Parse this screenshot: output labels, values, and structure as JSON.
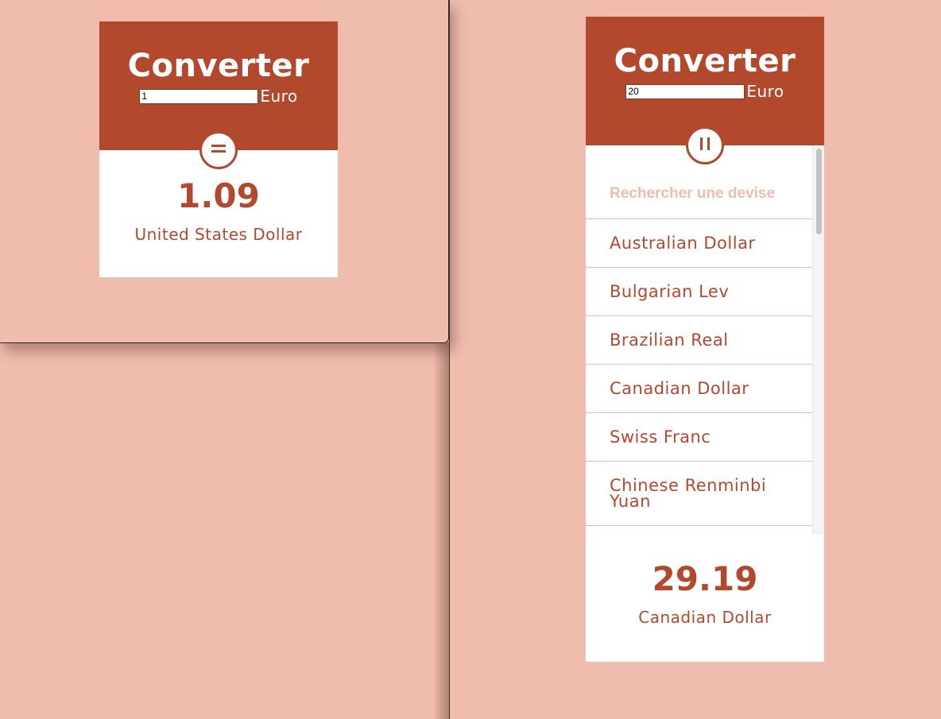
{
  "left_converter": {
    "title": "Converter",
    "amount_value": "1",
    "from_currency": "Euro",
    "toggle_icon": "equals-icon",
    "result_value": "1.09",
    "result_currency": "United States Dollar"
  },
  "right_converter": {
    "title": "Converter",
    "amount_value": "20",
    "from_currency": "Euro",
    "toggle_icon": "pause-icon",
    "search_placeholder": "Rechercher une devise",
    "currencies": [
      "Australian Dollar",
      "Bulgarian Lev",
      "Brazilian Real",
      "Canadian Dollar",
      "Swiss Franc",
      "Chinese Renminbi Yuan"
    ],
    "result_value": "29.19",
    "result_currency": "Canadian Dollar"
  },
  "colors": {
    "background": "#efbcad",
    "accent": "#b3492c",
    "card_body": "#ffffff"
  }
}
